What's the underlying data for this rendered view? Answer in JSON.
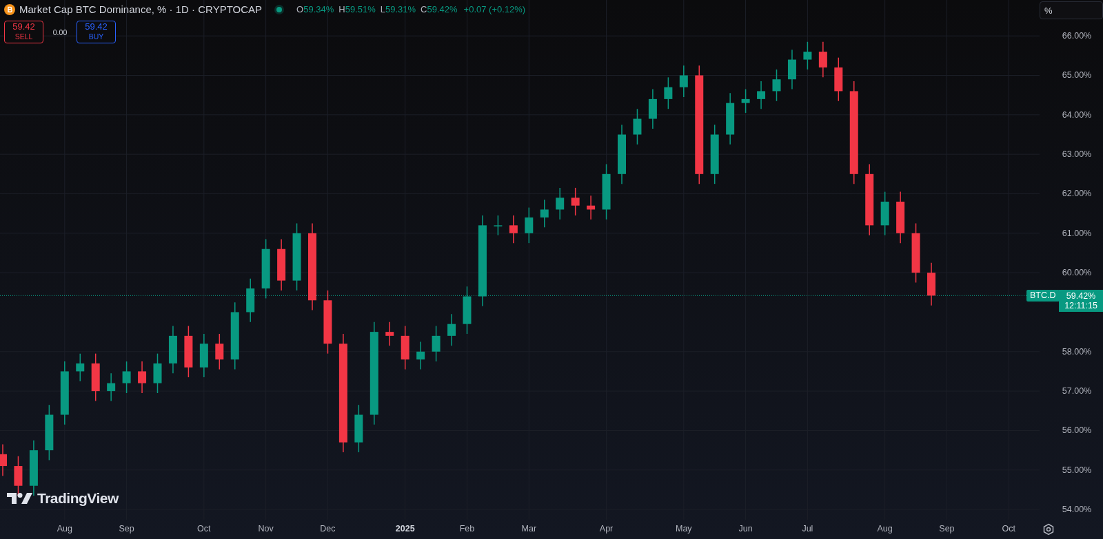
{
  "legend": {
    "title": "Market Cap BTC Dominance, % · 1D · CRYPTOCAP",
    "market_open": true,
    "ohlc": [
      {
        "label": "O",
        "value": "59.34%"
      },
      {
        "label": "H",
        "value": "59.51%"
      },
      {
        "label": "L",
        "value": "59.31%"
      },
      {
        "label": "C",
        "value": "59.42%"
      }
    ],
    "change": "+0.07 (+0.12%)"
  },
  "trade": {
    "sell_price": "59.42",
    "sell_label": "SELL",
    "spread": "0.00",
    "buy_price": "59.42",
    "buy_label": "BUY"
  },
  "scale_button": "%",
  "logo": {
    "text": "TradingView"
  },
  "price_label": {
    "symbol": "BTC.D",
    "countdown": "12:11:15"
  },
  "chart_data": {
    "type": "candlestick",
    "grid": true,
    "ylim": [
      53.74,
      66.91
    ],
    "yticks": [
      {
        "value": 66,
        "label": "66.00%"
      },
      {
        "value": 65,
        "label": "65.00%"
      },
      {
        "value": 64,
        "label": "64.00%"
      },
      {
        "value": 63,
        "label": "63.00%"
      },
      {
        "value": 62,
        "label": "62.00%"
      },
      {
        "value": 61,
        "label": "61.00%"
      },
      {
        "value": 60,
        "label": "60.00%"
      },
      {
        "value": 58,
        "label": "58.00%"
      },
      {
        "value": 57,
        "label": "57.00%"
      },
      {
        "value": 56,
        "label": "56.00%"
      },
      {
        "value": 55,
        "label": "55.00%"
      },
      {
        "value": 54,
        "label": "54.00%"
      }
    ],
    "ref_lines": [
      {
        "axis": "y",
        "value": 59.42,
        "color": "#089981",
        "label": "59.42%"
      }
    ],
    "categories": [
      null,
      null,
      null,
      null,
      "Aug",
      null,
      null,
      null,
      "Sep",
      null,
      null,
      null,
      null,
      "Oct",
      null,
      null,
      null,
      "Nov",
      null,
      null,
      null,
      "Dec",
      null,
      null,
      null,
      null,
      "2025",
      null,
      null,
      null,
      "Feb",
      null,
      null,
      null,
      "Mar",
      null,
      null,
      null,
      null,
      "Apr",
      null,
      null,
      null,
      null,
      "May",
      null,
      null,
      null,
      "Jun",
      null,
      null,
      null,
      "Jul",
      null,
      null,
      null,
      null,
      "Aug",
      null,
      null,
      null,
      "Sep",
      null,
      null,
      null,
      "Oct"
    ],
    "ohlc": [
      [
        55.4,
        55.65,
        54.85,
        55.1
      ],
      [
        55.1,
        55.35,
        54.35,
        54.6
      ],
      [
        54.6,
        55.75,
        54.35,
        55.5
      ],
      [
        55.5,
        56.65,
        55.25,
        56.4
      ],
      [
        56.4,
        57.75,
        56.15,
        57.5
      ],
      [
        57.5,
        57.95,
        57.25,
        57.7
      ],
      [
        57.7,
        57.95,
        56.75,
        57.0
      ],
      [
        57.0,
        57.45,
        56.75,
        57.2
      ],
      [
        57.2,
        57.75,
        56.95,
        57.5
      ],
      [
        57.5,
        57.75,
        56.95,
        57.2
      ],
      [
        57.2,
        57.95,
        56.95,
        57.7
      ],
      [
        57.7,
        58.65,
        57.45,
        58.4
      ],
      [
        58.4,
        58.65,
        57.35,
        57.6
      ],
      [
        57.6,
        58.45,
        57.35,
        58.2
      ],
      [
        58.2,
        58.45,
        57.55,
        57.8
      ],
      [
        57.8,
        59.25,
        57.55,
        59.0
      ],
      [
        59.0,
        59.85,
        58.75,
        59.6
      ],
      [
        59.6,
        60.85,
        59.35,
        60.6
      ],
      [
        60.6,
        60.85,
        59.55,
        59.8
      ],
      [
        59.8,
        61.25,
        59.55,
        61.0
      ],
      [
        61.0,
        61.25,
        59.05,
        59.3
      ],
      [
        59.3,
        59.55,
        57.95,
        58.2
      ],
      [
        58.2,
        58.45,
        55.45,
        55.7
      ],
      [
        55.7,
        56.65,
        55.45,
        56.4
      ],
      [
        56.4,
        58.75,
        56.15,
        58.5
      ],
      [
        58.5,
        58.75,
        58.15,
        58.4
      ],
      [
        58.4,
        58.65,
        57.55,
        57.8
      ],
      [
        57.8,
        58.25,
        57.55,
        58.0
      ],
      [
        58.0,
        58.65,
        57.75,
        58.4
      ],
      [
        58.4,
        58.95,
        58.15,
        58.7
      ],
      [
        58.7,
        59.65,
        58.45,
        59.4
      ],
      [
        59.4,
        61.45,
        59.15,
        61.2
      ],
      [
        61.2,
        61.45,
        60.95,
        61.2
      ],
      [
        61.2,
        61.45,
        60.75,
        61.0
      ],
      [
        61.0,
        61.65,
        60.75,
        61.4
      ],
      [
        61.4,
        61.85,
        61.15,
        61.6
      ],
      [
        61.6,
        62.15,
        61.35,
        61.9
      ],
      [
        61.9,
        62.15,
        61.45,
        61.7
      ],
      [
        61.7,
        61.95,
        61.35,
        61.6
      ],
      [
        61.6,
        62.75,
        61.35,
        62.5
      ],
      [
        62.5,
        63.75,
        62.25,
        63.5
      ],
      [
        63.5,
        64.15,
        63.25,
        63.9
      ],
      [
        63.9,
        64.65,
        63.65,
        64.4
      ],
      [
        64.4,
        64.95,
        64.15,
        64.7
      ],
      [
        64.7,
        65.25,
        64.45,
        65.0
      ],
      [
        65.0,
        65.25,
        62.25,
        62.5
      ],
      [
        62.5,
        63.75,
        62.25,
        63.5
      ],
      [
        63.5,
        64.55,
        63.25,
        64.3
      ],
      [
        64.3,
        64.65,
        64.05,
        64.4
      ],
      [
        64.4,
        64.85,
        64.15,
        64.6
      ],
      [
        64.6,
        65.15,
        64.35,
        64.9
      ],
      [
        64.9,
        65.65,
        64.65,
        65.4
      ],
      [
        65.4,
        65.85,
        65.15,
        65.6
      ],
      [
        65.6,
        65.85,
        64.95,
        65.2
      ],
      [
        65.2,
        65.45,
        64.35,
        64.6
      ],
      [
        64.6,
        64.85,
        62.25,
        62.5
      ],
      [
        62.5,
        62.75,
        60.95,
        61.2
      ],
      [
        61.2,
        62.05,
        60.95,
        61.8
      ],
      [
        61.8,
        62.05,
        60.75,
        61.0
      ],
      [
        61.0,
        61.25,
        59.75,
        60.0
      ],
      [
        60.0,
        60.25,
        59.17,
        59.42
      ],
      null,
      null,
      null,
      null,
      null
    ]
  }
}
